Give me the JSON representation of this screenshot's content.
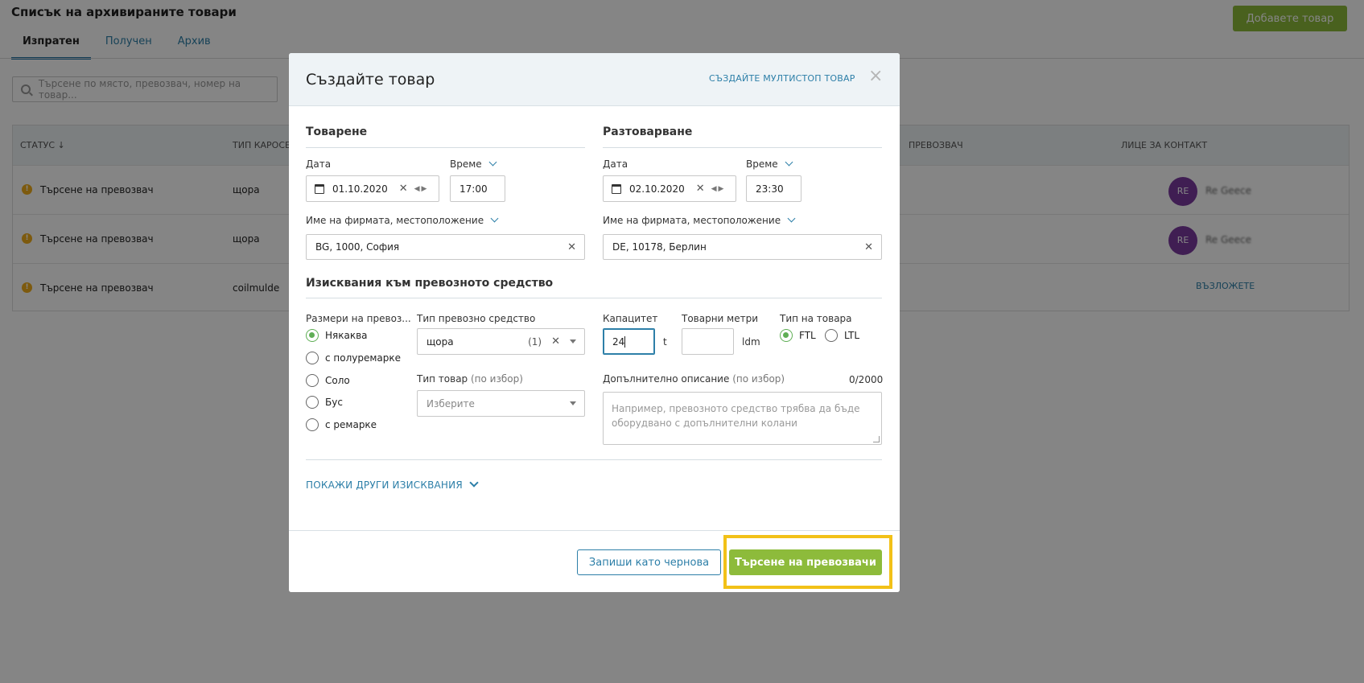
{
  "page": {
    "title": "Списък на архивираните товари",
    "add_button": "Добавете товар",
    "tabs": [
      "Изпратен",
      "Получен",
      "Архив"
    ],
    "search_placeholder": "Търсене по място, превозвач, номер на товар..."
  },
  "table": {
    "headers": {
      "status": "СТАТУС ↓",
      "body_type": "ТИП КАРОСЕР",
      "carrier": "ПРЕВОЗВАЧ",
      "contact": "ЛИЦЕ ЗА КОНТАКТ"
    },
    "rows": [
      {
        "status": "Търсене на превозвач",
        "body_type": "щора",
        "avatar": "RE"
      },
      {
        "status": "Търсене на превозвач",
        "body_type": "щора",
        "avatar": "RE"
      },
      {
        "status": "Търсене на превозвач",
        "body_type": "coilmulde",
        "action": "ВЪЗЛОЖЕТЕ"
      }
    ]
  },
  "modal": {
    "title": "Създайте товар",
    "multistop_link": "СЪЗДАЙТЕ МУЛТИСТОП ТОВАР",
    "close": "×",
    "loading": {
      "title": "Товарене",
      "date_label": "Дата",
      "date_value": "01.10.2020",
      "time_label": "Време",
      "time_value": "17:00",
      "company_label": "Име на фирмата, местоположение",
      "company_value": "BG, 1000, София"
    },
    "unloading": {
      "title": "Разтоварване",
      "date_label": "Дата",
      "date_value": "02.10.2020",
      "time_label": "Време",
      "time_value": "23:30",
      "company_label": "Име на фирмата, местоположение",
      "company_value": "DE, 10178, Берлин"
    },
    "requirements": {
      "title": "Изисквания към превозното средство",
      "sizes_label": "Размери на превоз...",
      "sizes": [
        {
          "label": "Някаква",
          "selected": true
        },
        {
          "label": "с полуремарке",
          "selected": false
        },
        {
          "label": "Соло",
          "selected": false
        },
        {
          "label": "Бус",
          "selected": false
        },
        {
          "label": "с ремарке",
          "selected": false
        }
      ],
      "vehicle_type_label": "Тип превозно средство",
      "vehicle_type_value": "щора",
      "vehicle_type_count": "(1)",
      "goods_type_label": "Тип товар",
      "optional": "(по избор)",
      "goods_type_placeholder": "Изберите",
      "capacity_label": "Капацитет",
      "capacity_value": "24",
      "capacity_unit": "t",
      "ldm_label": "Товарни метри",
      "ldm_value": "",
      "ldm_unit": "ldm",
      "load_type_label": "Тип на товара",
      "load_types": [
        {
          "label": "FTL",
          "selected": true
        },
        {
          "label": "LTL",
          "selected": false
        }
      ],
      "description_label": "Допълнително описание",
      "description_counter": "0/2000",
      "description_placeholder": "Например, превозното средство трябва да бъде оборудвано с допълнителни колани"
    },
    "show_other": "ПОКАЖИ ДРУГИ ИЗИСКВАНИЯ",
    "footer": {
      "draft_button": "Запиши като чернова",
      "search_button": "Търсене на превозвачи"
    }
  },
  "colors": {
    "accent": "#8dbb3b",
    "link": "#2d7fa8",
    "highlight": "#f2c118"
  }
}
